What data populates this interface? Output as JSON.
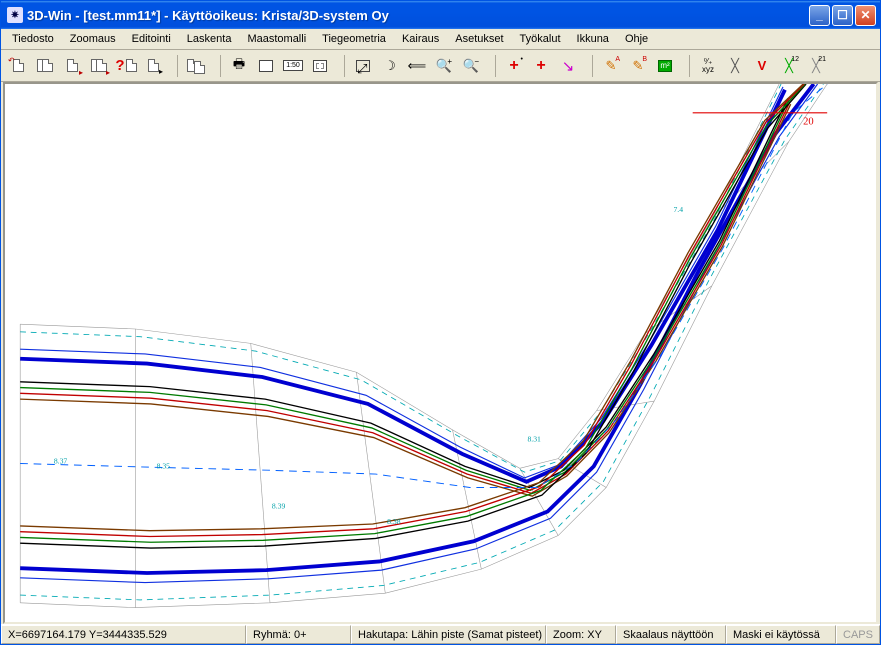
{
  "titlebar": {
    "title": "3D-Win - [test.mm11*] - Käyttöoikeus: Krista/3D-system Oy"
  },
  "menu": {
    "items": [
      "Tiedosto",
      "Zoomaus",
      "Editointi",
      "Laskenta",
      "Maastomalli",
      "Tiegeometria",
      "Kairaus",
      "Asetukset",
      "Työkalut",
      "Ikkuna",
      "Ohje"
    ]
  },
  "toolbar": {
    "groups": [
      [
        "open-file-icon",
        "open-multi-file-icon",
        "add-file-icon",
        "add-multi-file-icon",
        "help-file-icon",
        "view-file-icon"
      ],
      [
        "copy-icon"
      ],
      [
        "print-icon",
        "tool-generic-icon",
        "scale-150-icon",
        "tool-generic-2-icon"
      ],
      [
        "zoom-extents-icon",
        "zoom-window-icon",
        "zoom-prev-icon",
        "zoom-in-icon",
        "zoom-out-icon"
      ],
      [
        "add-point-red-icon",
        "add-point-red-q-icon",
        "point-magenta-icon"
      ],
      [
        "measure-a-icon",
        "measure-b-icon",
        "area-green-icon"
      ],
      [
        "xyz-icon",
        "grid-x-icon",
        "grid-v-red-icon",
        "grid-x-green-icon",
        "grid-x21-icon"
      ]
    ]
  },
  "status": {
    "coords": "X=6697164.179 Y=3444335.529",
    "group": "Ryhmä: 0+",
    "search": "Hakutapa: Lähin piste (Samat pisteet)",
    "zoom": "Zoom: XY",
    "scale": "Skaalaus näyttöön",
    "mask": "Maski ei käytössä",
    "caps": "CAPS"
  },
  "canvas": {
    "annotation_20": "20",
    "point_labels": [
      "8.37",
      "8.35",
      "8.39",
      "8.38",
      "8.31",
      "7.4"
    ]
  }
}
